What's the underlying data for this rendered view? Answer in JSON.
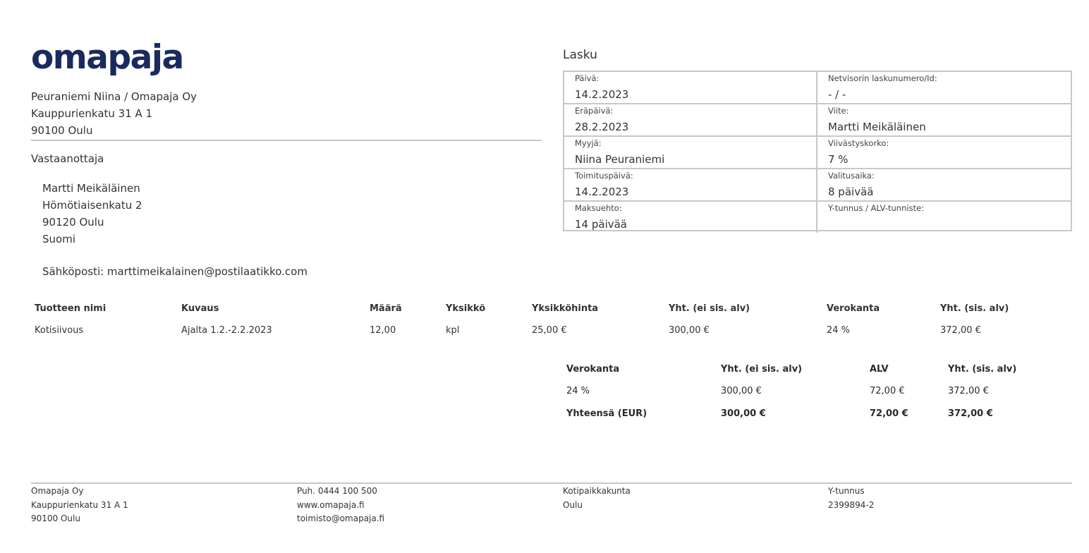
{
  "brand": {
    "logo_text": "omapaja",
    "color": "#1a2a5e"
  },
  "sender": {
    "name": "Peuraniemi Niina / Omapaja Oy",
    "street": "Kauppurienkatu 31 A 1",
    "city": "90100 Oulu"
  },
  "recipient": {
    "title": "Vastaanottaja",
    "name": "Martti Meikäläinen",
    "street": "Hömötiaisenkatu 2",
    "city": "90120 Oulu",
    "country": "Suomi",
    "email": "Sähköposti: marttimeikalainen@postilaatikko.com"
  },
  "invoice": {
    "title": "Lasku",
    "fields": [
      {
        "label": "Päivä:",
        "value": "14.2.2023"
      },
      {
        "label": "Netvisorin laskunumero/Id:",
        "value": "- / -"
      },
      {
        "label": "Eräpäivä:",
        "value": "28.2.2023"
      },
      {
        "label": "Viite:",
        "value": "Martti Meikäläinen"
      },
      {
        "label": "Myyjä:",
        "value": "Niina Peuraniemi"
      },
      {
        "label": "Viivästyskorko:",
        "value": "7 %"
      },
      {
        "label": "Toimituspäivä:",
        "value": "14.2.2023"
      },
      {
        "label": "Valitusaika:",
        "value": "8 päivää"
      },
      {
        "label": "Maksuehto:",
        "value": "14 päivää"
      },
      {
        "label": "Y-tunnus / ALV-tunniste:",
        "value": ""
      }
    ]
  },
  "items": {
    "headers": [
      "Tuotteen nimi",
      "Kuvaus",
      "Määrä",
      "Yksikkö",
      "Yksikköhinta",
      "Yht. (ei sis. alv)",
      "Verokanta",
      "Yht. (sis. alv)"
    ],
    "rows": [
      [
        "Kotisiivous",
        "Ajalta 1.2.-2.2.2023",
        "12,00",
        "kpl",
        "25,00 €",
        "300,00 €",
        "24 %",
        "372,00 €"
      ]
    ]
  },
  "vat_summary": {
    "headers": [
      "Verokanta",
      "Yht. (ei sis. alv)",
      "ALV",
      "Yht. (sis. alv)"
    ],
    "rows": [
      [
        "24 %",
        "300,00 €",
        "72,00 €",
        "372,00 €"
      ]
    ],
    "total": [
      "Yhteensä (EUR)",
      "300,00 €",
      "72,00 €",
      "372,00 €"
    ]
  },
  "footer": {
    "company": [
      "Omapaja Oy",
      "Kauppurienkatu 31 A 1",
      "90100 Oulu"
    ],
    "contact": [
      "Puh. 0444 100 500",
      "www.omapaja.fi",
      "toimisto@omapaja.fi"
    ],
    "domicile": [
      "Kotipaikkakunta",
      "Oulu"
    ],
    "business_id": [
      "Y-tunnus",
      "2399894-2"
    ]
  }
}
